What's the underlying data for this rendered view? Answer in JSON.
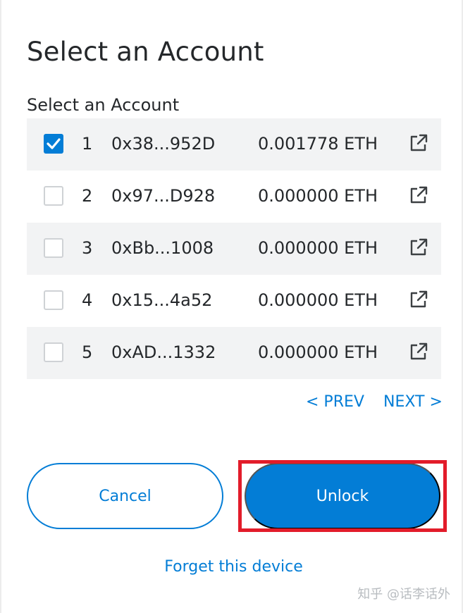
{
  "title": "Select an Account",
  "subtitle": "Select an Account",
  "accounts": [
    {
      "index": "1",
      "address": "0x38...952D",
      "balance": "0.001778 ETH",
      "checked": true,
      "icon": "external-link-icon"
    },
    {
      "index": "2",
      "address": "0x97...D928",
      "balance": "0.000000 ETH",
      "checked": false,
      "icon": "external-link-icon"
    },
    {
      "index": "3",
      "address": "0xBb...1008",
      "balance": "0.000000 ETH",
      "checked": false,
      "icon": "external-link-icon"
    },
    {
      "index": "4",
      "address": "0x15...4a52",
      "balance": "0.000000 ETH",
      "checked": false,
      "icon": "external-link-icon"
    },
    {
      "index": "5",
      "address": "0xAD...1332",
      "balance": "0.000000 ETH",
      "checked": false,
      "icon": "external-link-icon"
    }
  ],
  "pagination": {
    "prev_label": "< PREV",
    "next_label": "NEXT >"
  },
  "buttons": {
    "cancel_label": "Cancel",
    "unlock_label": "Unlock"
  },
  "forget_label": "Forget this device",
  "watermark": "知乎 @话李话外",
  "colors": {
    "accent": "#037dd6",
    "highlight": "#e21c2a",
    "list_background": "#f2f3f4",
    "text": "#24272a"
  }
}
